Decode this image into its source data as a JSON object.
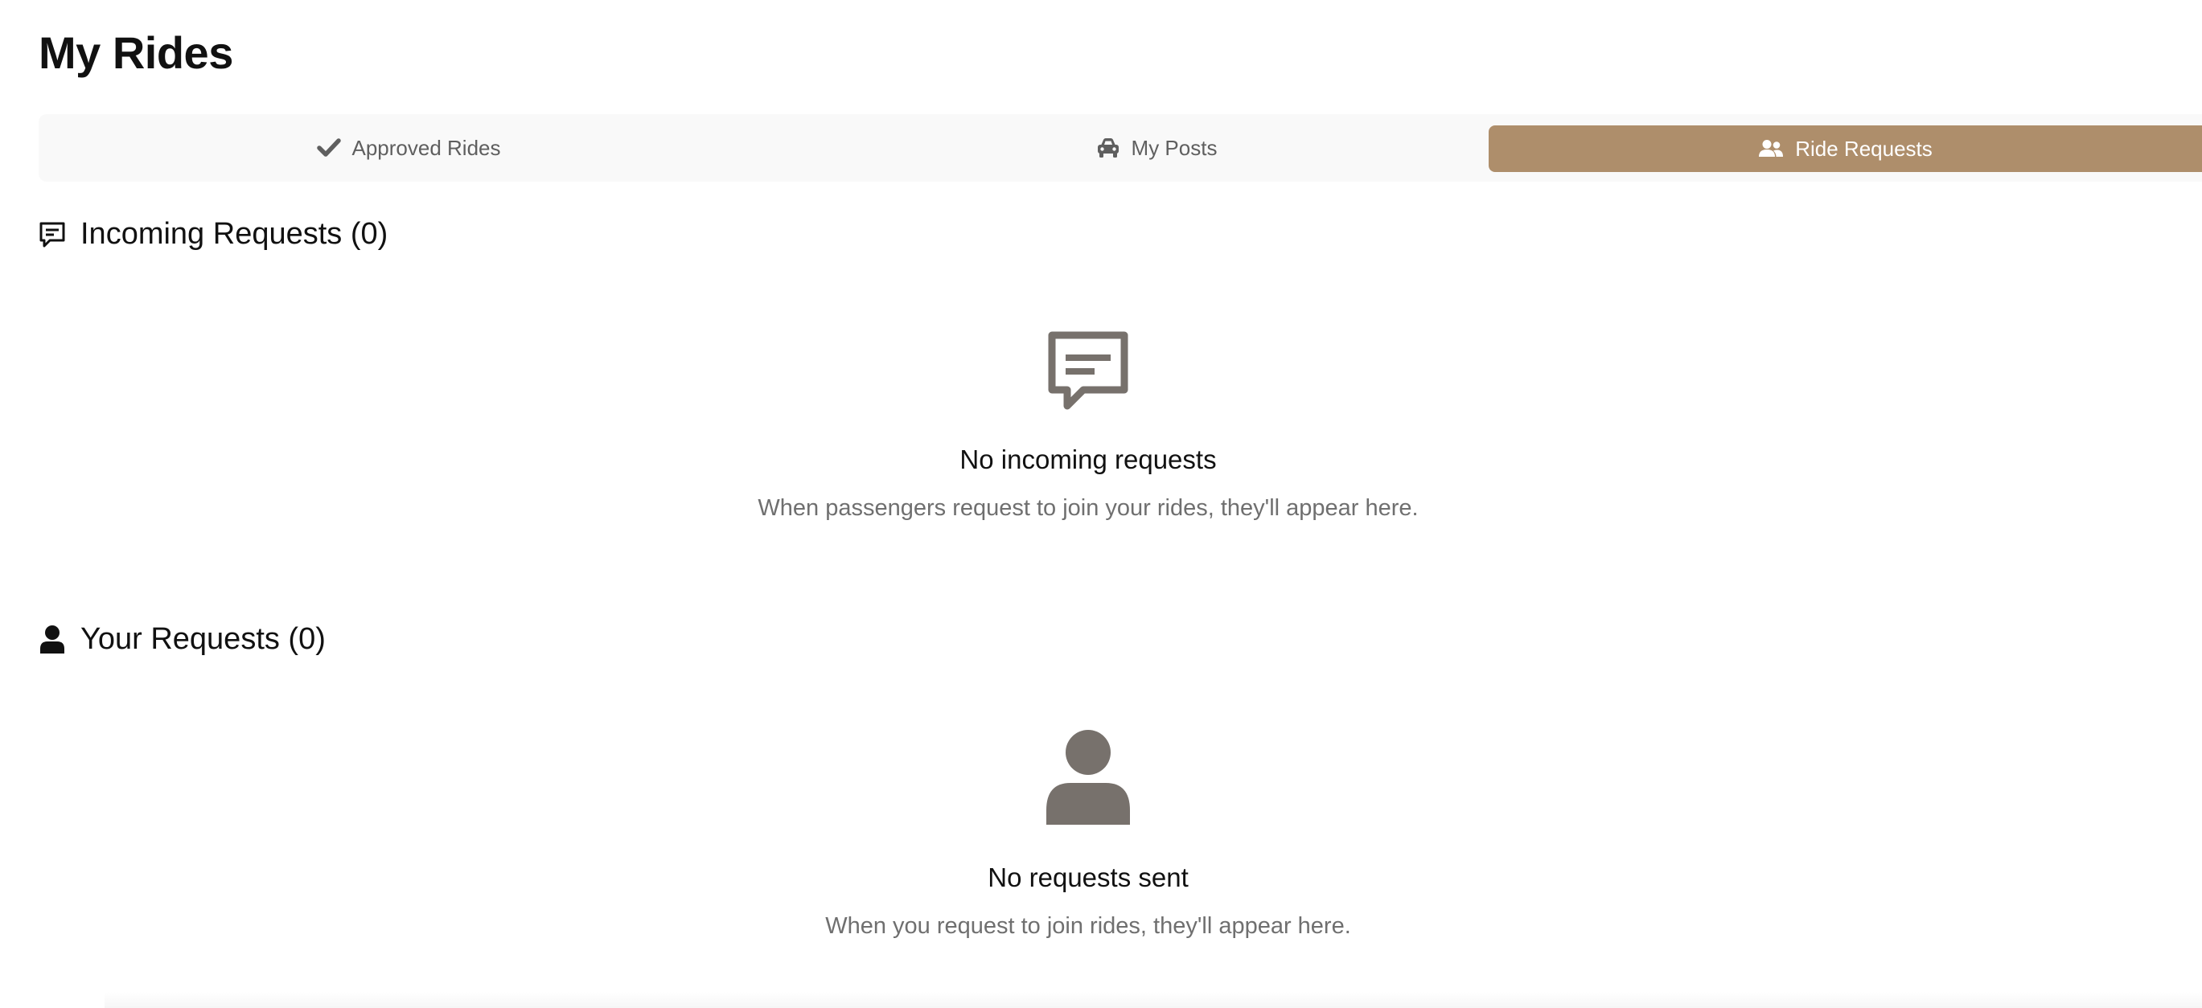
{
  "page": {
    "title": "My Rides"
  },
  "tabs": [
    {
      "label": "Approved Rides",
      "icon": "check-icon",
      "active": false
    },
    {
      "label": "My Posts",
      "icon": "car-icon",
      "active": false
    },
    {
      "label": "Ride Requests",
      "icon": "users-icon",
      "active": true
    }
  ],
  "incoming": {
    "heading": "Incoming Requests (0)",
    "icon": "message-square-icon",
    "empty_icon": "message-square-icon",
    "empty_title": "No incoming requests",
    "empty_desc": "When passengers request to join your rides, they'll appear here."
  },
  "yours": {
    "heading": "Your Requests (0)",
    "icon": "user-icon",
    "empty_icon": "user-icon",
    "empty_title": "No requests sent",
    "empty_desc": "When you request to join rides, they'll appear here."
  },
  "colors": {
    "accent": "#ae8e6b",
    "tabbar_bg": "#f9f9f9",
    "muted_text": "#6f6f6f",
    "empty_icon": "#77716c"
  }
}
